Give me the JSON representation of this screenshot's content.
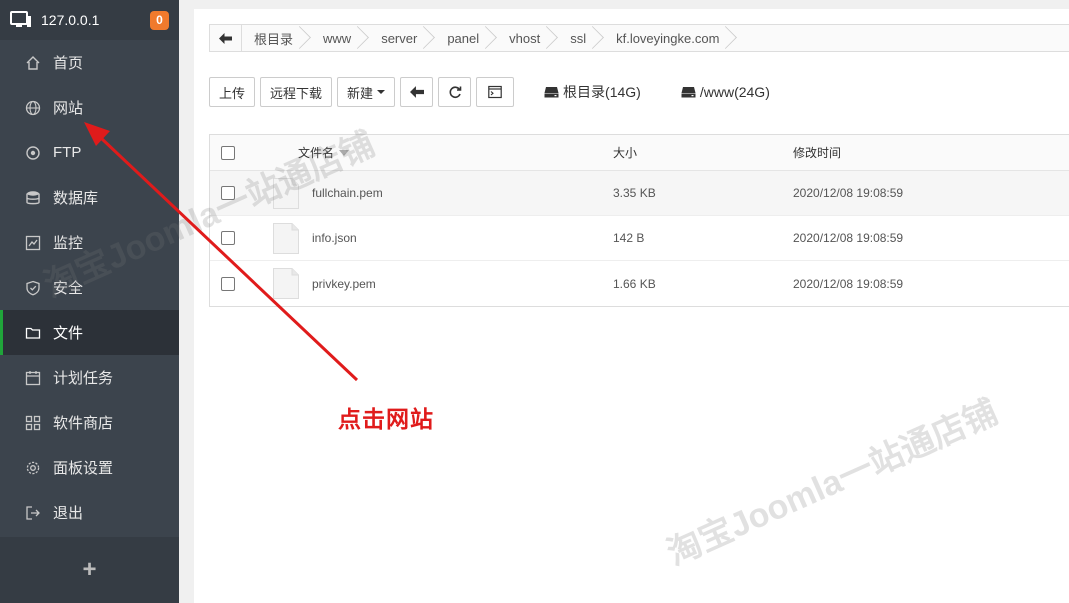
{
  "sidebar": {
    "host": "127.0.0.1",
    "badge_count": "0",
    "items": [
      {
        "label": "首页",
        "icon": "home-icon"
      },
      {
        "label": "网站",
        "icon": "globe-icon"
      },
      {
        "label": "FTP",
        "icon": "ftp-icon"
      },
      {
        "label": "数据库",
        "icon": "database-icon"
      },
      {
        "label": "监控",
        "icon": "monitor-chart-icon"
      },
      {
        "label": "安全",
        "icon": "shield-icon"
      },
      {
        "label": "文件",
        "icon": "folder-icon",
        "active": true
      },
      {
        "label": "计划任务",
        "icon": "calendar-icon"
      },
      {
        "label": "软件商店",
        "icon": "apps-grid-icon"
      },
      {
        "label": "面板设置",
        "icon": "gear-icon"
      },
      {
        "label": "退出",
        "icon": "logout-icon"
      }
    ],
    "add_label": "+"
  },
  "breadcrumb": [
    "根目录",
    "www",
    "server",
    "panel",
    "vhost",
    "ssl",
    "kf.loveyingke.com"
  ],
  "toolbar": {
    "upload": "上传",
    "remote_download": "远程下载",
    "new": "新建",
    "disks": [
      {
        "label": "根目录(14G)"
      },
      {
        "label": "/www(24G)"
      }
    ]
  },
  "table": {
    "headers": {
      "name": "文件名",
      "size": "大小",
      "modified": "修改时间"
    },
    "rows": [
      {
        "name": "fullchain.pem",
        "size": "3.35 KB",
        "modified": "2020/12/08 19:08:59"
      },
      {
        "name": "info.json",
        "size": "142 B",
        "modified": "2020/12/08 19:08:59"
      },
      {
        "name": "privkey.pem",
        "size": "1.66 KB",
        "modified": "2020/12/08 19:08:59"
      }
    ]
  },
  "annotation": {
    "label": "点击网站",
    "color": "#e01b1b"
  },
  "watermark": "淘宝Joomla一站通店铺",
  "colors": {
    "sidebar_bg": "#3c444d",
    "active_accent": "#20a53a",
    "badge": "#f07a2c"
  }
}
